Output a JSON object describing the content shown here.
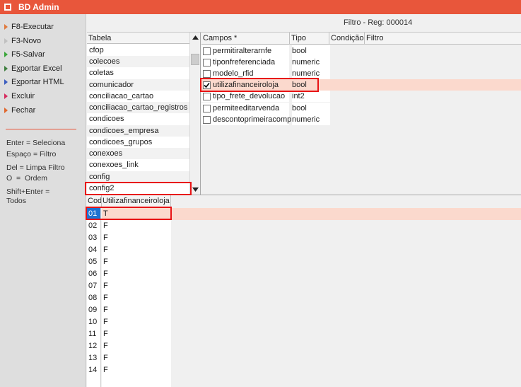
{
  "window": {
    "title": "BD Admin"
  },
  "sidebar": {
    "items": [
      {
        "label": "F8-Executar",
        "icon": "run-arrow-icon"
      },
      {
        "label": "F3-Novo",
        "icon": "new-arrow-icon"
      },
      {
        "label": "F5-Salvar",
        "icon": "save-arrow-icon"
      },
      {
        "label_pre": "E",
        "label_u": "x",
        "label_post": "portar Excel",
        "icon": "export-excel-arrow-icon"
      },
      {
        "label_pre": "E",
        "label_u": "x",
        "label_post": "portar HTML",
        "icon": "export-html-arrow-icon"
      },
      {
        "label": "Excluir",
        "icon": "delete-arrow-icon"
      },
      {
        "label": "Fechar",
        "icon": "close-arrow-icon"
      }
    ],
    "hints": [
      "Enter = Seleciona",
      "Espaço = Filtro",
      "Del = Limpa Filtro",
      "O  =  Ordem",
      "Shift+Enter =\nTodos"
    ]
  },
  "filterbar": {
    "text": "Filtro - Reg: 000014"
  },
  "tabela": {
    "header": "Tabela",
    "rows": [
      "cfop",
      "colecoes",
      "coletas",
      "comunicador",
      "conciliacao_cartao",
      "conciliacao_cartao_registros",
      "condicoes",
      "condicoes_empresa",
      "condicoes_grupos",
      "conexoes",
      "conexoes_link",
      "config",
      "config2"
    ],
    "selected": "config2"
  },
  "campos": {
    "headers": {
      "campos": "Campos *",
      "tipo": "Tipo",
      "condicao": "Condição",
      "filtro": "Filtro"
    },
    "rows": [
      {
        "name": "permitiralterarnfe",
        "type": "bool",
        "checked": false
      },
      {
        "name": "tiponfreferenciada",
        "type": "numeric",
        "checked": false
      },
      {
        "name": "modelo_rfid",
        "type": "numeric",
        "checked": false
      },
      {
        "name": "utilizafinanceiroloja",
        "type": "bool",
        "checked": true
      },
      {
        "name": "tipo_frete_devolucao",
        "type": "int2",
        "checked": false
      },
      {
        "name": "permiteeditarvenda",
        "type": "bool",
        "checked": false
      },
      {
        "name": "descontoprimeiracomp",
        "type": "numeric",
        "checked": false
      }
    ]
  },
  "grid": {
    "headers": {
      "cod": "Cod",
      "field": "Utilizafinanceiroloja"
    },
    "rows": [
      {
        "cod": "01",
        "value": "T"
      },
      {
        "cod": "02",
        "value": "F"
      },
      {
        "cod": "03",
        "value": "F"
      },
      {
        "cod": "04",
        "value": "F"
      },
      {
        "cod": "05",
        "value": "F"
      },
      {
        "cod": "06",
        "value": "F"
      },
      {
        "cod": "07",
        "value": "F"
      },
      {
        "cod": "08",
        "value": "F"
      },
      {
        "cod": "09",
        "value": "F"
      },
      {
        "cod": "10",
        "value": "F"
      },
      {
        "cod": "11",
        "value": "F"
      },
      {
        "cod": "12",
        "value": "F"
      },
      {
        "cod": "13",
        "value": "F"
      },
      {
        "cod": "14",
        "value": "F"
      }
    ]
  },
  "colors": {
    "accent": "#e8563b",
    "highlight": "#fbd9cd",
    "selection": "#1e72d1",
    "annotation": "#e81416"
  }
}
